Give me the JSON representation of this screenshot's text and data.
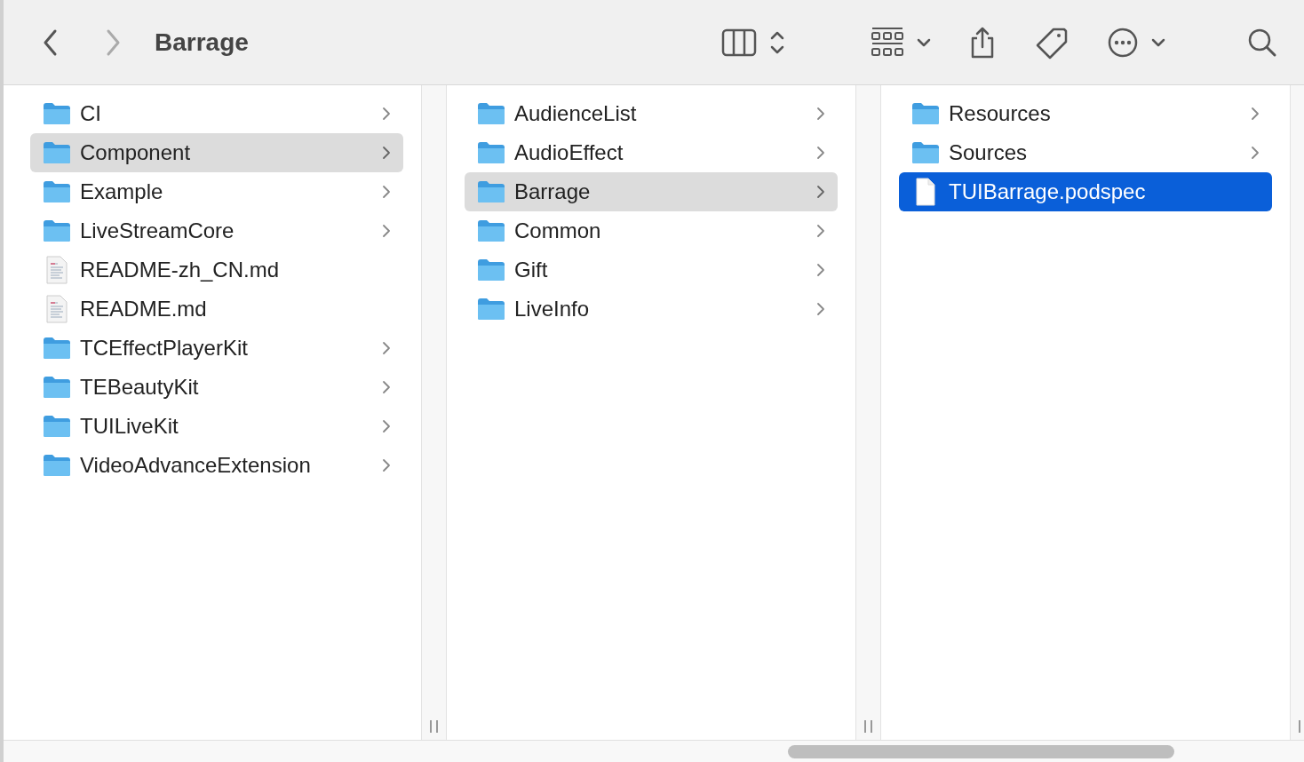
{
  "toolbar": {
    "title": "Barrage"
  },
  "columns": [
    {
      "focused": false,
      "items": [
        {
          "name": "CI",
          "kind": "folder",
          "selected": false
        },
        {
          "name": "Component",
          "kind": "folder",
          "selected": true
        },
        {
          "name": "Example",
          "kind": "folder",
          "selected": false
        },
        {
          "name": "LiveStreamCore",
          "kind": "folder",
          "selected": false
        },
        {
          "name": "README-zh_CN.md",
          "kind": "document",
          "selected": false
        },
        {
          "name": "README.md",
          "kind": "document",
          "selected": false
        },
        {
          "name": "TCEffectPlayerKit",
          "kind": "folder",
          "selected": false
        },
        {
          "name": "TEBeautyKit",
          "kind": "folder",
          "selected": false
        },
        {
          "name": "TUILiveKit",
          "kind": "folder",
          "selected": false
        },
        {
          "name": "VideoAdvanceExtension",
          "kind": "folder",
          "selected": false
        }
      ]
    },
    {
      "focused": false,
      "items": [
        {
          "name": "AudienceList",
          "kind": "folder",
          "selected": false
        },
        {
          "name": "AudioEffect",
          "kind": "folder",
          "selected": false
        },
        {
          "name": "Barrage",
          "kind": "folder",
          "selected": true
        },
        {
          "name": "Common",
          "kind": "folder",
          "selected": false
        },
        {
          "name": "Gift",
          "kind": "folder",
          "selected": false
        },
        {
          "name": "LiveInfo",
          "kind": "folder",
          "selected": false
        }
      ]
    },
    {
      "focused": true,
      "items": [
        {
          "name": "Resources",
          "kind": "folder",
          "selected": false
        },
        {
          "name": "Sources",
          "kind": "folder",
          "selected": false
        },
        {
          "name": "TUIBarrage.podspec",
          "kind": "file",
          "selected": true
        }
      ]
    }
  ]
}
